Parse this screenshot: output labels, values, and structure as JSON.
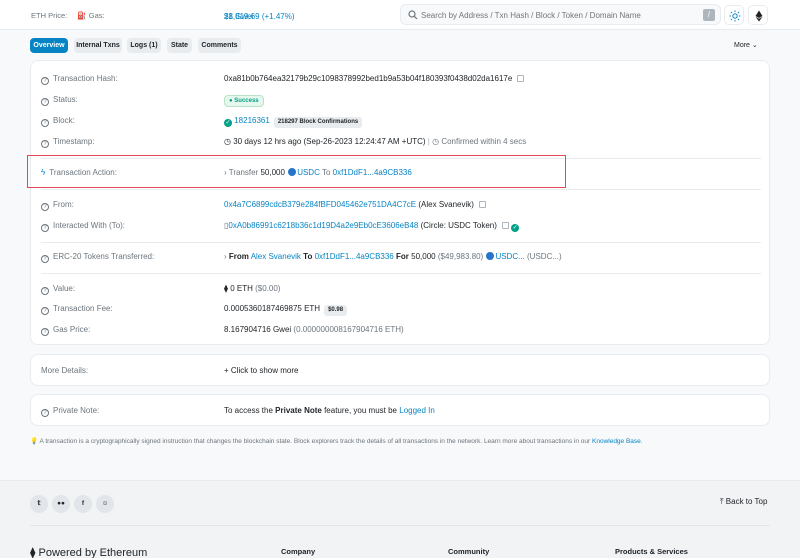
{
  "header": {
    "eth_price_label": "ETH Price:",
    "eth_price_value": "$1,819.69 (+1.47%)",
    "gas_label": "Gas:",
    "gas_value": "28 Gwei",
    "search_placeholder": "Search by Address / Txn Hash / Block / Token / Domain Name",
    "search_shortcut": "/"
  },
  "tabs": [
    {
      "label": "Overview",
      "active": true
    },
    {
      "label": "Internal Txns",
      "active": false
    },
    {
      "label": "Logs (1)",
      "active": false
    },
    {
      "label": "State",
      "active": false
    },
    {
      "label": "Comments",
      "active": false
    }
  ],
  "more_label": "More",
  "details": {
    "tx_hash_label": "Transaction Hash:",
    "tx_hash": "0xa81b0b764ea32179b29c1098378992bed1b9a53b04f180393f0438d02da1617e",
    "status_label": "Status:",
    "status_value": "Success",
    "block_label": "Block:",
    "block_value": "18216361",
    "block_confirmations": "218297 Block Confirmations",
    "timestamp_label": "Timestamp:",
    "timestamp_value": "30 days 12 hrs ago (Sep-26-2023 12:24:47 AM +UTC)",
    "timestamp_sep": "|",
    "confirmed_within": "Confirmed within 4 secs",
    "action_label": "Transaction Action:",
    "action_verb": "Transfer",
    "action_amount": "50,000",
    "action_token": "USDC",
    "action_to": "To",
    "action_to_addr": "0xf1DdF1...4a9CB336",
    "from_label": "From:",
    "from_addr": "0x4a7C6899cdcB379e284fBFD045462e751DA4C7cE",
    "from_name": "(Alex Svanevik)",
    "interacted_label": "Interacted With (To):",
    "interacted_addr": "0xA0b86991c6218b36c1d19D4a2e9Eb0cE3606eB48",
    "interacted_name": "(Circle: USDC Token)",
    "erc20_label": "ERC-20 Tokens Transferred:",
    "erc20_from_word": "From",
    "erc20_from_name": "Alex Svanevik",
    "erc20_to_word": "To",
    "erc20_to_addr": "0xf1DdF1...4a9CB336",
    "erc20_for_word": "For",
    "erc20_amount": "50,000",
    "erc20_usd": "($49,983.80)",
    "erc20_token": "USDC...",
    "erc20_token_paren": "(USDC...)",
    "value_label": "Value:",
    "value_eth": "0 ETH",
    "value_usd": "($0.00)",
    "fee_label": "Transaction Fee:",
    "fee_value": "0.0005360187469875 ETH",
    "fee_usd": "$0.98",
    "gas_price_label": "Gas Price:",
    "gas_price_value": "8.167904716 Gwei",
    "gas_price_eth": "(0.000000008167904716 ETH)"
  },
  "more_details": {
    "label": "More Details:",
    "link": "Click to show more"
  },
  "private_note": {
    "label": "Private Note:",
    "text_before": "To access the",
    "bold": "Private Note",
    "text_after": "feature, you must be",
    "link": "Logged In"
  },
  "info_note": {
    "text": "A transaction is a cryptographically signed instruction that changes the blockchain state. Block explorers track the details of all transactions in the network. Learn more about transactions in our",
    "link": "Knowledge Base",
    "end": "."
  },
  "footer": {
    "back_to_top": "Back to Top",
    "powered": "Powered by Ethereum",
    "col_company": "Company",
    "col_community": "Community",
    "col_products": "Products & Services"
  },
  "colors": {
    "accent": "#0784c3",
    "success": "#00a186",
    "highlight": "#e0495a"
  }
}
